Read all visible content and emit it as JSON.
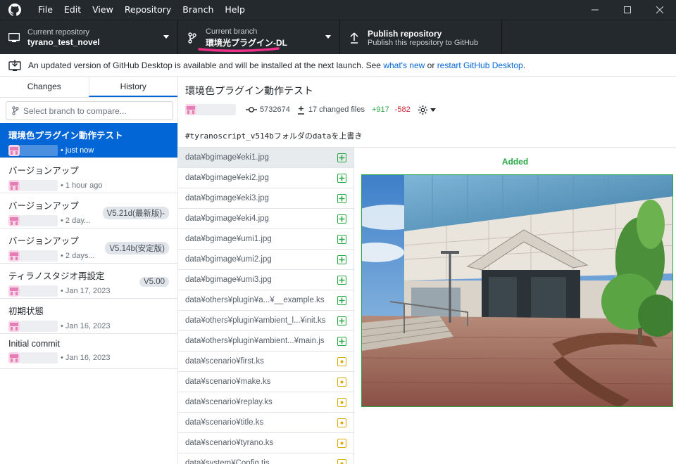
{
  "menu": [
    "File",
    "Edit",
    "View",
    "Repository",
    "Branch",
    "Help"
  ],
  "toolbar": {
    "repo_title": "Current repository",
    "repo_value": "tyrano_test_novel",
    "branch_title": "Current branch",
    "branch_value": "環境光プラグイン-DL",
    "publish_title": "Publish repository",
    "publish_value": "Publish this repository to GitHub"
  },
  "banner": {
    "text": "An updated version of GitHub Desktop is available and will be installed at the next launch. See",
    "link1": "what's new",
    "mid": "or",
    "link2": "restart GitHub Desktop",
    "end": "."
  },
  "tabs": {
    "changes": "Changes",
    "history": "History"
  },
  "compare": {
    "placeholder": "Select branch to compare..."
  },
  "commits": [
    {
      "title": "環境色プラグイン動作テスト",
      "time": "• just now",
      "tag": ""
    },
    {
      "title": "バージョンアップ",
      "time": "• 1 hour ago",
      "tag": ""
    },
    {
      "title": "バージョンアップ",
      "time": "• 2 day...",
      "tag": "V5.21d(最新版)-"
    },
    {
      "title": "バージョンアップ",
      "time": "• 2 days...",
      "tag": "V5.14b(安定版)"
    },
    {
      "title": "ティラノスタジオ再設定",
      "time": "• Jan 17, 2023",
      "tag": "V5.00"
    },
    {
      "title": "初期状態",
      "time": "• Jan 16, 2023",
      "tag": ""
    },
    {
      "title": "Initial commit",
      "time": "• Jan 16, 2023",
      "tag": ""
    }
  ],
  "commit_detail": {
    "title": "環境色プラグイン動作テスト",
    "sha": "5732674",
    "changed": "17 changed files",
    "added": "+917",
    "removed": "-582",
    "description": "#tyranoscript_v514bフォルダのdataを上書き"
  },
  "files": [
    {
      "name": "data¥bgimage¥eki1.jpg",
      "status": "added"
    },
    {
      "name": "data¥bgimage¥eki2.jpg",
      "status": "added"
    },
    {
      "name": "data¥bgimage¥eki3.jpg",
      "status": "added"
    },
    {
      "name": "data¥bgimage¥eki4.jpg",
      "status": "added"
    },
    {
      "name": "data¥bgimage¥umi1.jpg",
      "status": "added"
    },
    {
      "name": "data¥bgimage¥umi2.jpg",
      "status": "added"
    },
    {
      "name": "data¥bgimage¥umi3.jpg",
      "status": "added"
    },
    {
      "name": "data¥others¥plugin¥a...¥__example.ks",
      "status": "added"
    },
    {
      "name": "data¥others¥plugin¥ambient_l...¥init.ks",
      "status": "added"
    },
    {
      "name": "data¥others¥plugin¥ambient...¥main.js",
      "status": "added"
    },
    {
      "name": "data¥scenario¥first.ks",
      "status": "modified"
    },
    {
      "name": "data¥scenario¥make.ks",
      "status": "modified"
    },
    {
      "name": "data¥scenario¥replay.ks",
      "status": "modified"
    },
    {
      "name": "data¥scenario¥title.ks",
      "status": "modified"
    },
    {
      "name": "data¥scenario¥tyrano.ks",
      "status": "modified"
    },
    {
      "name": "data¥system¥Config.tjs",
      "status": "modified"
    }
  ],
  "diff": {
    "label": "Added"
  },
  "colors": {
    "accent": "#0366d6",
    "added": "#28a745",
    "modified": "#dbab09",
    "removed": "#cb2431",
    "dark": "#24292e"
  }
}
